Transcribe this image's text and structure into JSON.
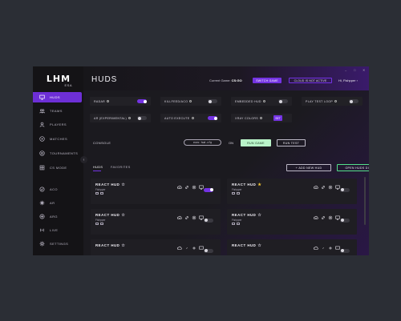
{
  "app": {
    "logo": "LHM",
    "edition": "ESA",
    "title": "HUDS"
  },
  "sidebar": {
    "items": [
      {
        "label": "HUDS",
        "icon": "monitor-icon",
        "active": true
      },
      {
        "label": "TEAMS",
        "icon": "teams-icon",
        "active": false
      },
      {
        "label": "PLAYERS",
        "icon": "players-icon",
        "active": false
      },
      {
        "label": "MATCHES",
        "icon": "matches-icon",
        "active": false
      },
      {
        "label": "TOURNAMENTS",
        "icon": "trophy-icon",
        "active": false
      },
      {
        "label": "CS MODE",
        "icon": "cs-mode-icon",
        "active": false
      },
      {
        "label": "ACO",
        "icon": "aco-icon",
        "active": false
      },
      {
        "label": "AR",
        "icon": "ar-icon",
        "active": false
      },
      {
        "label": "ARG",
        "icon": "arg-icon",
        "active": false
      },
      {
        "label": "LIVE",
        "icon": "live-icon",
        "active": false
      },
      {
        "label": "SETTINGS",
        "icon": "gear-icon",
        "active": false
      }
    ]
  },
  "header": {
    "current_game_label": "Current Game:",
    "current_game_value": "CS:GO",
    "switch_game": "SWITCH GAME",
    "cloud_status": "CLOUD IS NOT ACTIVE",
    "user": "Hi, Fishpper",
    "window_controls": [
      "–",
      "□",
      "✕"
    ]
  },
  "options": {
    "radar": "RADAR",
    "killfeed": "KILLFEED/ACO",
    "embedded_hud": "EMBEDDED HUD",
    "play_test_loop": "PLAY TEST LOOP",
    "ar": "AR (EXPERIMENTAL)",
    "auto_execute": "AUTO EXECUTE",
    "xray_colors": "XRAY COLORS",
    "set": "SET",
    "states": {
      "radar": true,
      "killfeed": false,
      "embedded_hud": false,
      "play_test_loop": false,
      "ar": false,
      "auto_execute": true
    }
  },
  "console": {
    "label": "CONSOLE",
    "command": "exec hud.cfg",
    "on": "ON",
    "run_game": "RUN GAME",
    "run_test": "RUN TEST"
  },
  "tabs": {
    "huds": "HUDS",
    "favorites": "FAVORITES"
  },
  "actions": {
    "add_new_hud": "ADD NEW HUD",
    "open_huds_directory": "OPEN HUDS DIRECTORY"
  },
  "huds": [
    {
      "name": "REACT HUD",
      "author": "Fishpper",
      "favorite": false,
      "enabled": true
    },
    {
      "name": "REACT HUD",
      "author": "Fishpper",
      "favorite": true,
      "enabled": false
    },
    {
      "name": "REACT HUD",
      "author": "Fishpper",
      "favorite": false,
      "enabled": false
    },
    {
      "name": "REACT HUD",
      "author": "Fishpper",
      "favorite": false,
      "enabled": false
    },
    {
      "name": "REACT HUD",
      "author": "",
      "favorite": false,
      "enabled": false
    },
    {
      "name": "REACT HUD",
      "author": "",
      "favorite": false,
      "enabled": false
    }
  ],
  "colors": {
    "accent": "#7433e3",
    "run_game": "#b9f3c9",
    "favorite": "#f5c631",
    "open_dir_border": "#54e08b"
  }
}
